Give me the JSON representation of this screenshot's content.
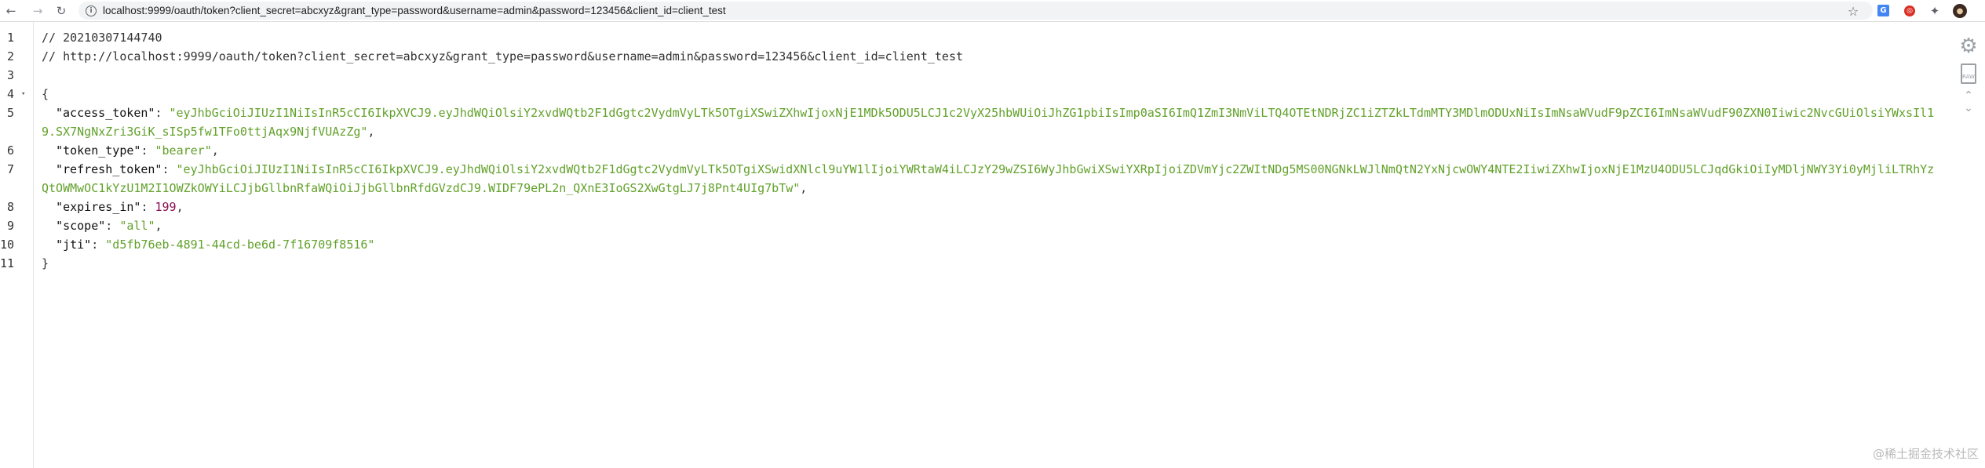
{
  "browser": {
    "back_glyph": "←",
    "forward_glyph": "→",
    "reload_glyph": "↻",
    "info_glyph": "i",
    "url": "localhost:9999/oauth/token?client_secret=abcxyz&grant_type=password&username=admin&password=123456&client_id=client_test",
    "star_glyph": "☆",
    "translate_ext_glyph": "G",
    "red_ext_glyph": "◎",
    "extensions_glyph": "✦",
    "avatar_glyph": "●",
    "icons": [
      "back-icon",
      "forward-icon",
      "reload-icon",
      "info-icon",
      "star-icon",
      "translate-extension-icon",
      "extension-icon",
      "extensions-puzzle-icon",
      "avatar"
    ]
  },
  "viewer": {
    "line_numbers": [
      "1",
      "2",
      "3",
      "4",
      "5",
      "6",
      "7",
      "8",
      "9",
      "10",
      "11"
    ],
    "fold_glyph": "▾",
    "comment_timestamp": "// 20210307144740",
    "comment_url": "// http://localhost:9999/oauth/token?client_secret=abcxyz&grant_type=password&username=admin&password=123456&client_id=client_test",
    "open_brace": "{",
    "close_brace": "}",
    "colon": ": ",
    "comma": ",",
    "fields": {
      "access_token": {
        "key": "\"access_token\"",
        "value": "\"eyJhbGciOiJIUzI1NiIsInR5cCI6IkpXVCJ9.eyJhdWQiOlsiY2xvdWQtb2F1dGgtc2VydmVyLTk5OTgiXSwiZXhwIjoxNjE1MDk5ODU5LCJ1c2VyX25hbWUiOiJhZG1pbiIsImp0aSI6ImQ1ZmI3NmViLTQ4OTEtNDRjZC1iZTZkLTdmMTY3MDlmODUxNiIsImNsaWVudF9pZCI6ImNsaWVudF90ZXN0Iiwic2NvcGUiOlsiYWxsIl19.SX7NgNxZri3GiK_sISp5fw1TFo0ttjAqx9NjfVUAzZg\""
      },
      "token_type": {
        "key": "\"token_type\"",
        "value": "\"bearer\""
      },
      "refresh_token": {
        "key": "\"refresh_token\"",
        "value": "\"eyJhbGciOiJIUzI1NiIsInR5cCI6IkpXVCJ9.eyJhdWQiOlsiY2xvdWQtb2F1dGgtc2VydmVyLTk5OTgiXSwidXNlcl9uYW1lIjoiYWRtaW4iLCJzY29wZSI6WyJhbGwiXSwiYXRpIjoiZDVmYjc2ZWItNDg5MS00NGNkLWJlNmQtN2YxNjcwOWY4NTE2IiwiZXhwIjoxNjE1MzU4ODU5LCJqdGkiOiIyMDljNWY3Yi0yMjliLTRhYzQtOWMwOC1kYzU1M2I1OWZkOWYiLCJjbGllbnRfaWQiOiJjbGllbnRfdGVzdCJ9.WIDF79ePL2n_QXnE3IoGS2XwGtgLJ7j8Pnt4UIg7bTw\""
      },
      "expires_in": {
        "key": "\"expires_in\"",
        "value": "199"
      },
      "scope": {
        "key": "\"scope\"",
        "value": "\"all\""
      },
      "jti": {
        "key": "\"jti\"",
        "value": "\"d5fb76eb-4891-44cd-be6d-7f16709f8516\""
      }
    },
    "tools": {
      "gear_glyph": "⚙",
      "raw_label": "RAW",
      "scroll_up_glyph": "⌃",
      "scroll_down_glyph": "⌄"
    }
  },
  "watermark": "@稀土掘金技术社区"
}
